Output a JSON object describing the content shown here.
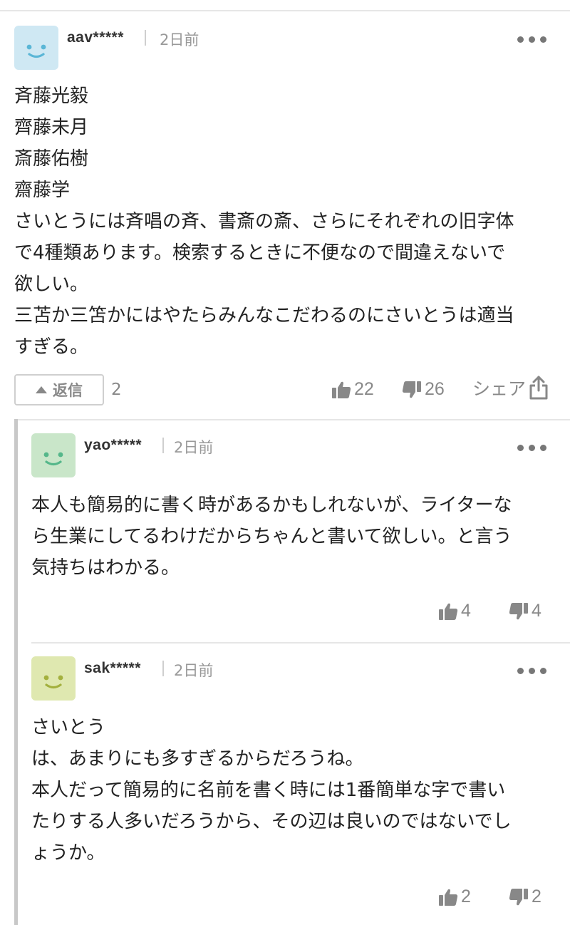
{
  "comment": {
    "username": "aav*****",
    "time": "2日前",
    "avatar_color": "#cfe8f3",
    "avatar_face_color": "#5ab6d6",
    "lines": [
      "斉藤光毅",
      "齊藤未月",
      "斎藤佑樹",
      "齋藤学",
      "さいとうには斉唱の斉、書斎の斎、さらにそれぞれの旧字体",
      "で4種類あります。検索するときに不便なので間違えないで",
      "欲しい。",
      "三苫か三笘かにはやたらみんなこだわるのにさいとうは適当",
      "すぎる。"
    ],
    "reply_label": "返信",
    "reply_count": "2",
    "likes": "22",
    "dislikes": "26",
    "share_label": "シェア"
  },
  "replies": [
    {
      "username": "yao*****",
      "time": "2日前",
      "avatar_color": "#c9e6c9",
      "avatar_face_color": "#55b78a",
      "lines": [
        "本人も簡易的に書く時があるかもしれないが、ライターな",
        "ら生業にしてるわけだからちゃんと書いて欲しい。と言う",
        "気持ちはわかる。"
      ],
      "likes": "4",
      "dislikes": "4"
    },
    {
      "username": "sak*****",
      "time": "2日前",
      "avatar_color": "#dfe8b0",
      "avatar_face_color": "#a3b03e",
      "lines": [
        "さいとう",
        "は、あまりにも多すぎるからだろうね。",
        "本人だって簡易的に名前を書く時には1番簡単な字で書い",
        "たりする人多いだろうから、その辺は良いのではないでし",
        "ょうか。"
      ],
      "likes": "2",
      "dislikes": "2"
    }
  ],
  "icons": {
    "more": "more-dots-icon",
    "like": "thumbs-up-icon",
    "dislike": "thumbs-down-icon",
    "share": "share-icon",
    "reply": "triangle-up-icon"
  }
}
